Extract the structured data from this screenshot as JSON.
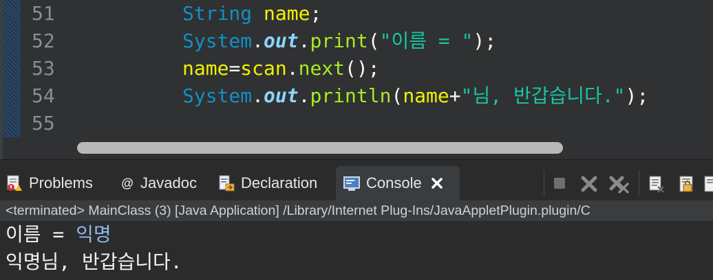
{
  "editor": {
    "lines": [
      {
        "num": "51",
        "parts": [
          [
            "kw-type",
            "String"
          ],
          [
            "punct",
            " "
          ],
          [
            "var",
            "name"
          ],
          [
            "punct",
            ";"
          ]
        ]
      },
      {
        "num": "52",
        "parts": [
          [
            "kw-type",
            "System"
          ],
          [
            "punct",
            "."
          ],
          [
            "field",
            "out"
          ],
          [
            "punct",
            "."
          ],
          [
            "method",
            "print"
          ],
          [
            "punct",
            "("
          ],
          [
            "str",
            "\"이름 = \""
          ],
          [
            "punct",
            ");"
          ]
        ]
      },
      {
        "num": "53",
        "parts": [
          [
            "var",
            "name"
          ],
          [
            "punct",
            "="
          ],
          [
            "var",
            "scan"
          ],
          [
            "punct",
            "."
          ],
          [
            "method",
            "next"
          ],
          [
            "punct",
            "();"
          ]
        ]
      },
      {
        "num": "54",
        "parts": [
          [
            "kw-type",
            "System"
          ],
          [
            "punct",
            "."
          ],
          [
            "field",
            "out"
          ],
          [
            "punct",
            "."
          ],
          [
            "method",
            "println"
          ],
          [
            "punct",
            "("
          ],
          [
            "var",
            "name"
          ],
          [
            "punct",
            "+"
          ],
          [
            "str",
            "\"님, 반갑습니다.\""
          ],
          [
            "punct",
            ");"
          ]
        ]
      },
      {
        "num": "55",
        "parts": []
      }
    ]
  },
  "tabs": {
    "problems": "Problems",
    "javadoc": "Javadoc",
    "declaration": "Declaration",
    "console": "Console"
  },
  "status": {
    "text": "<terminated> MainClass (3) [Java Application] /Library/Internet Plug-Ins/JavaAppletPlugin.plugin/C"
  },
  "console": {
    "line1_prompt": "이름 = ",
    "line1_input": "익명",
    "line2": "익명님, 반갑습니다."
  },
  "colors": {
    "string": "#17c6a3",
    "type": "#1290c3",
    "method": "#a7ec21",
    "variable": "#f2f200"
  }
}
